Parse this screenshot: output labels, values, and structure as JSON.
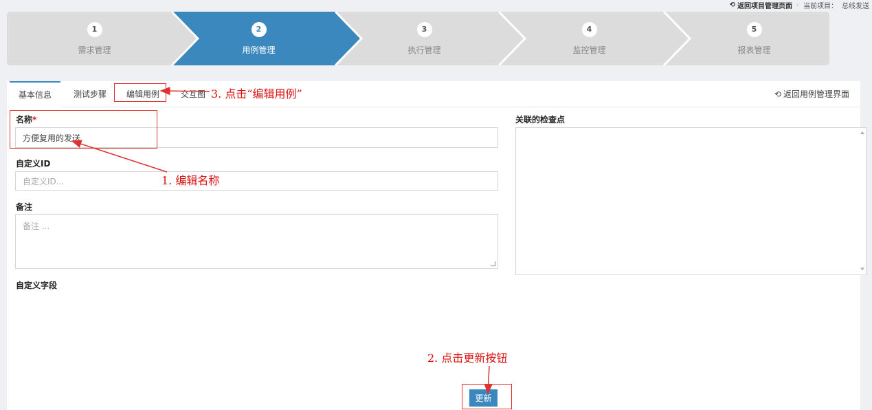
{
  "topbar": {
    "back_label": "返回项目管理页面",
    "current_project_label": "当前项目：",
    "current_project_value": "总线发送"
  },
  "wizard": {
    "steps": [
      {
        "number": "1",
        "label": "需求管理"
      },
      {
        "number": "2",
        "label": "用例管理"
      },
      {
        "number": "3",
        "label": "执行管理"
      },
      {
        "number": "4",
        "label": "监控管理"
      },
      {
        "number": "5",
        "label": "报表管理"
      }
    ],
    "active_step": 2,
    "active_color": "#3b88bf"
  },
  "tabs": {
    "items": [
      {
        "label": "基本信息"
      },
      {
        "label": "测试步骤"
      },
      {
        "label": "编辑用例"
      },
      {
        "label": "交互图"
      }
    ],
    "back_label": "返回用例管理界面"
  },
  "form": {
    "name_label": "名称",
    "name_required_mark": "*",
    "name_value": "方便复用的发送",
    "custom_id_label": "自定义ID",
    "custom_id_placeholder": "自定义ID...",
    "remark_label": "备注",
    "remark_placeholder": "备注 ...",
    "custom_fields_label": "自定义字段",
    "checkpoints_label": "关联的检查点",
    "update_button": "更新"
  },
  "annotations": {
    "step1": "1. 编辑名称",
    "step2": "2. 点击更新按钮",
    "step3": "3. 点击“编辑用例”",
    "color": "#e03131"
  }
}
